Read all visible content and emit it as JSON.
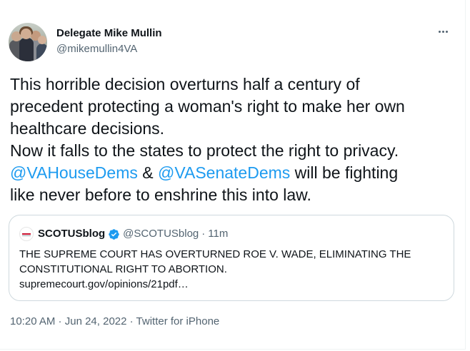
{
  "author": {
    "display_name": "Delegate Mike Mullin",
    "handle": "@mikemullin4VA"
  },
  "more_icon": "more-horizontal-icon",
  "tweet": {
    "line1": "This horrible decision overturns half a century of",
    "line2": "precedent protecting a woman's right to make her own",
    "line3": "healthcare decisions.",
    "line4": "Now it falls to the states to protect the right to privacy.",
    "mention1": "@VAHouseDems",
    "amp": " & ",
    "mention2": "@VASenateDems",
    "line5_tail": " will be fighting",
    "line6": "like never before to enshrine this into law."
  },
  "quote": {
    "name": "SCOTUSblog",
    "handle": "@SCOTUSblog",
    "dot": "·",
    "time": "11m",
    "text": "THE SUPREME COURT HAS OVERTURNED ROE V. WADE, ELIMINATING THE CONSTITUTIONAL RIGHT TO ABORTION.",
    "link": "supremecourt.gov/opinions/21pdf…"
  },
  "meta": {
    "time": "10:20 AM",
    "sep1": " · ",
    "date": "Jun 24, 2022",
    "sep2": " · ",
    "source": "Twitter for iPhone"
  },
  "colors": {
    "accent": "#1d9bf0",
    "text": "#0f1419",
    "secondary": "#536471",
    "border": "#cfd9de"
  }
}
